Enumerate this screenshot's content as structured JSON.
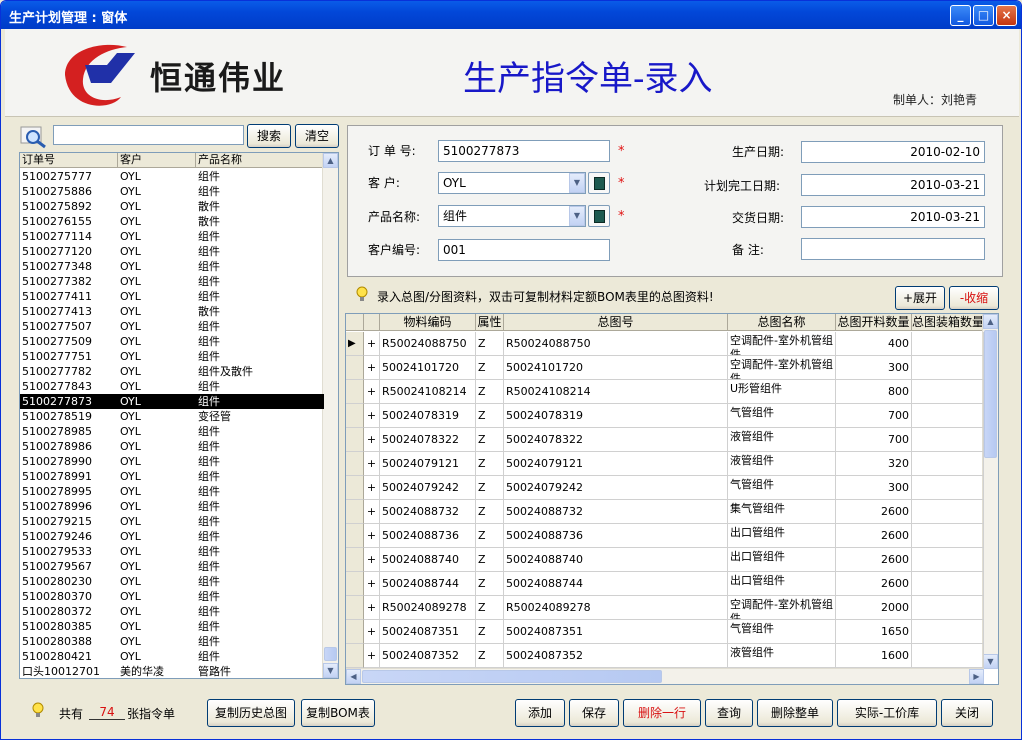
{
  "window": {
    "title": "生产计划管理 : 窗体",
    "minimize": "_",
    "maximize": "□",
    "close": "×"
  },
  "header": {
    "brand": "恒通伟业",
    "title": "生产指令单-录入",
    "maker": "制单人：刘艳青"
  },
  "search": {
    "value": "",
    "search_btn": "搜索",
    "clear_btn": "清空"
  },
  "order_list": {
    "columns": [
      "订单号",
      "客户",
      "产品名称"
    ],
    "rows": [
      [
        "5100275777",
        "OYL",
        "组件"
      ],
      [
        "5100275886",
        "OYL",
        "组件"
      ],
      [
        "5100275892",
        "OYL",
        "散件"
      ],
      [
        "5100276155",
        "OYL",
        "散件"
      ],
      [
        "5100277114",
        "OYL",
        "组件"
      ],
      [
        "5100277120",
        "OYL",
        "组件"
      ],
      [
        "5100277348",
        "OYL",
        "组件"
      ],
      [
        "5100277382",
        "OYL",
        "组件"
      ],
      [
        "5100277411",
        "OYL",
        "组件"
      ],
      [
        "5100277413",
        "OYL",
        "散件"
      ],
      [
        "5100277507",
        "OYL",
        "组件"
      ],
      [
        "5100277509",
        "OYL",
        "组件"
      ],
      [
        "5100277751",
        "OYL",
        "组件"
      ],
      [
        "5100277782",
        "OYL",
        "组件及散件"
      ],
      [
        "5100277843",
        "OYL",
        "组件"
      ],
      [
        "5100277873",
        "OYL",
        "组件"
      ],
      [
        "5100278519",
        "OYL",
        "变径管"
      ],
      [
        "5100278985",
        "OYL",
        "组件"
      ],
      [
        "5100278986",
        "OYL",
        "组件"
      ],
      [
        "5100278990",
        "OYL",
        "组件"
      ],
      [
        "5100278991",
        "OYL",
        "组件"
      ],
      [
        "5100278995",
        "OYL",
        "组件"
      ],
      [
        "5100278996",
        "OYL",
        "组件"
      ],
      [
        "5100279215",
        "OYL",
        "组件"
      ],
      [
        "5100279246",
        "OYL",
        "组件"
      ],
      [
        "5100279533",
        "OYL",
        "组件"
      ],
      [
        "5100279567",
        "OYL",
        "组件"
      ],
      [
        "5100280230",
        "OYL",
        "组件"
      ],
      [
        "5100280370",
        "OYL",
        "组件"
      ],
      [
        "5100280372",
        "OYL",
        "组件"
      ],
      [
        "5100280385",
        "OYL",
        "组件"
      ],
      [
        "5100280388",
        "OYL",
        "组件"
      ],
      [
        "5100280421",
        "OYL",
        "组件"
      ],
      [
        "口头10012701",
        "美的华凌",
        "管路件"
      ]
    ],
    "selected_index": 15
  },
  "form": {
    "order_no_label": "订 单 号:",
    "order_no": "5100277873",
    "customer_label": "客    户:",
    "customer": "OYL",
    "product_label": "产品名称:",
    "product": "组件",
    "customer_code_label": "客户编号:",
    "customer_code": "001",
    "prod_date_label": "生产日期:",
    "prod_date": "2010-02-10",
    "plan_date_label": "计划完工日期:",
    "plan_date": "2010-03-21",
    "delivery_date_label": "交货日期:",
    "delivery_date": "2010-03-21",
    "remark_label": "备    注:",
    "remark": "",
    "required_mark": "*"
  },
  "hint": {
    "text": "录入总图/分图资料，双击可复制材料定额BOM表里的总图资料!",
    "expand_btn": "+展开",
    "collapse_btn": "-收缩"
  },
  "grid": {
    "columns": [
      "物料编码",
      "属性",
      "总图号",
      "总图名称",
      "总图开料数量",
      "总图装箱数量"
    ],
    "rows": [
      [
        "R50024088750",
        "Z",
        "R50024088750",
        "空调配件-室外机管组件",
        "400",
        ""
      ],
      [
        "50024101720",
        "Z",
        "50024101720",
        "空调配件-室外机管组件",
        "300",
        ""
      ],
      [
        "R50024108214",
        "Z",
        "R50024108214",
        "U形管组件",
        "800",
        ""
      ],
      [
        "50024078319",
        "Z",
        "50024078319",
        "气管组件",
        "700",
        ""
      ],
      [
        "50024078322",
        "Z",
        "50024078322",
        "液管组件",
        "700",
        ""
      ],
      [
        "50024079121",
        "Z",
        "50024079121",
        "液管组件",
        "320",
        ""
      ],
      [
        "50024079242",
        "Z",
        "50024079242",
        "气管组件",
        "300",
        ""
      ],
      [
        "50024088732",
        "Z",
        "50024088732",
        "集气管组件",
        "2600",
        ""
      ],
      [
        "50024088736",
        "Z",
        "50024088736",
        "出口管组件",
        "2600",
        ""
      ],
      [
        "50024088740",
        "Z",
        "50024088740",
        "出口管组件",
        "2600",
        ""
      ],
      [
        "50024088744",
        "Z",
        "50024088744",
        "出口管组件",
        "2600",
        ""
      ],
      [
        "R50024089278",
        "Z",
        "R50024089278",
        "空调配件-室外机管组件",
        "2000",
        ""
      ],
      [
        "50024087351",
        "Z",
        "50024087351",
        "气管组件",
        "1650",
        ""
      ],
      [
        "50024087352",
        "Z",
        "50024087352",
        "液管组件",
        "1600",
        ""
      ]
    ],
    "expand_mark": "+",
    "current_row_mark": "▶"
  },
  "footer": {
    "total_label": "共有",
    "total_count": "74",
    "total_unit": "张指令单",
    "buttons": {
      "copy_history": "复制历史总图",
      "copy_bom": "复制BOM表",
      "add": "添加",
      "save": "保存",
      "delete_row": "删除一行",
      "query": "查询",
      "delete_all": "删除整单",
      "price_lib": "实际-工价库",
      "close": "关闭"
    }
  },
  "colors": {
    "accent": "#1818c8",
    "danger": "#d81010",
    "titlebar": "#0247d8"
  }
}
